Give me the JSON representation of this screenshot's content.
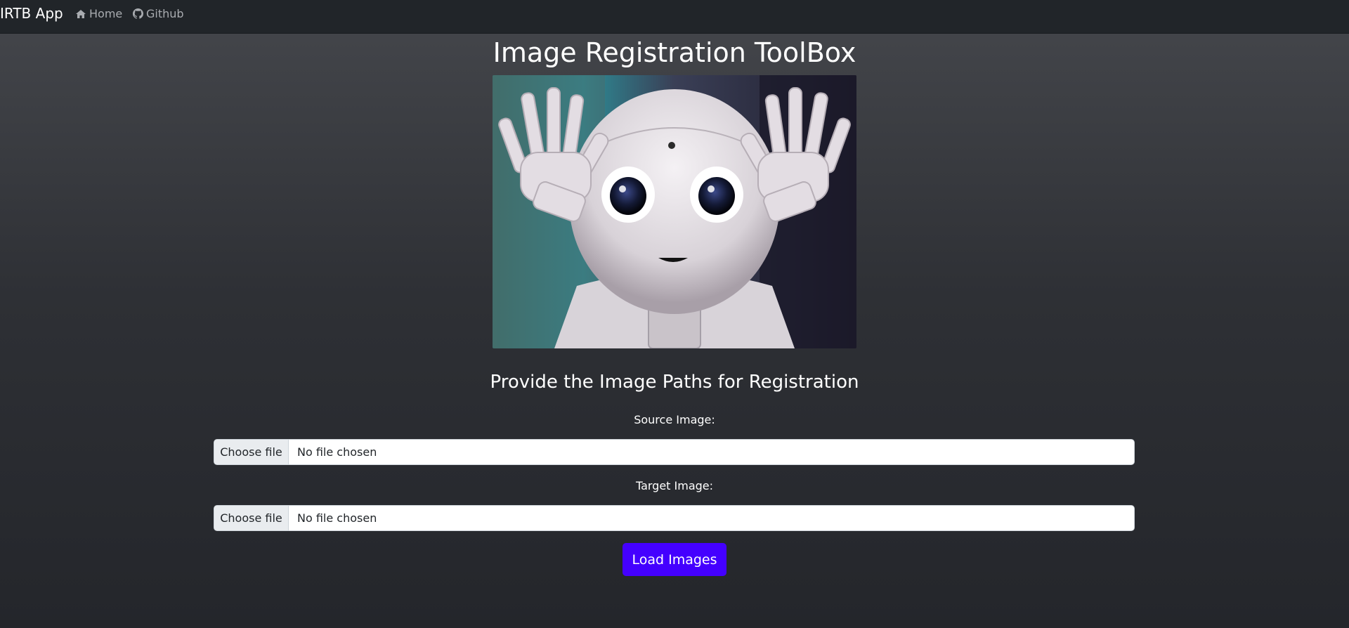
{
  "navbar": {
    "brand": "IRTB App",
    "links": [
      {
        "label": "Home",
        "icon": "home-icon"
      },
      {
        "label": "Github",
        "icon": "github-icon"
      }
    ]
  },
  "main": {
    "title": "Image Registration ToolBox",
    "hero_image": "robot-photo",
    "subtitle": "Provide the Image Paths for Registration",
    "source": {
      "label": "Source Image:",
      "button": "Choose file",
      "status": "No file chosen"
    },
    "target": {
      "label": "Target Image:",
      "button": "Choose file",
      "status": "No file chosen"
    },
    "submit_label": "Load Images"
  },
  "colors": {
    "navbar_bg": "#212529",
    "accent": "#4400ff",
    "text": "#ffffff",
    "nav_link": "#a9acb0"
  }
}
